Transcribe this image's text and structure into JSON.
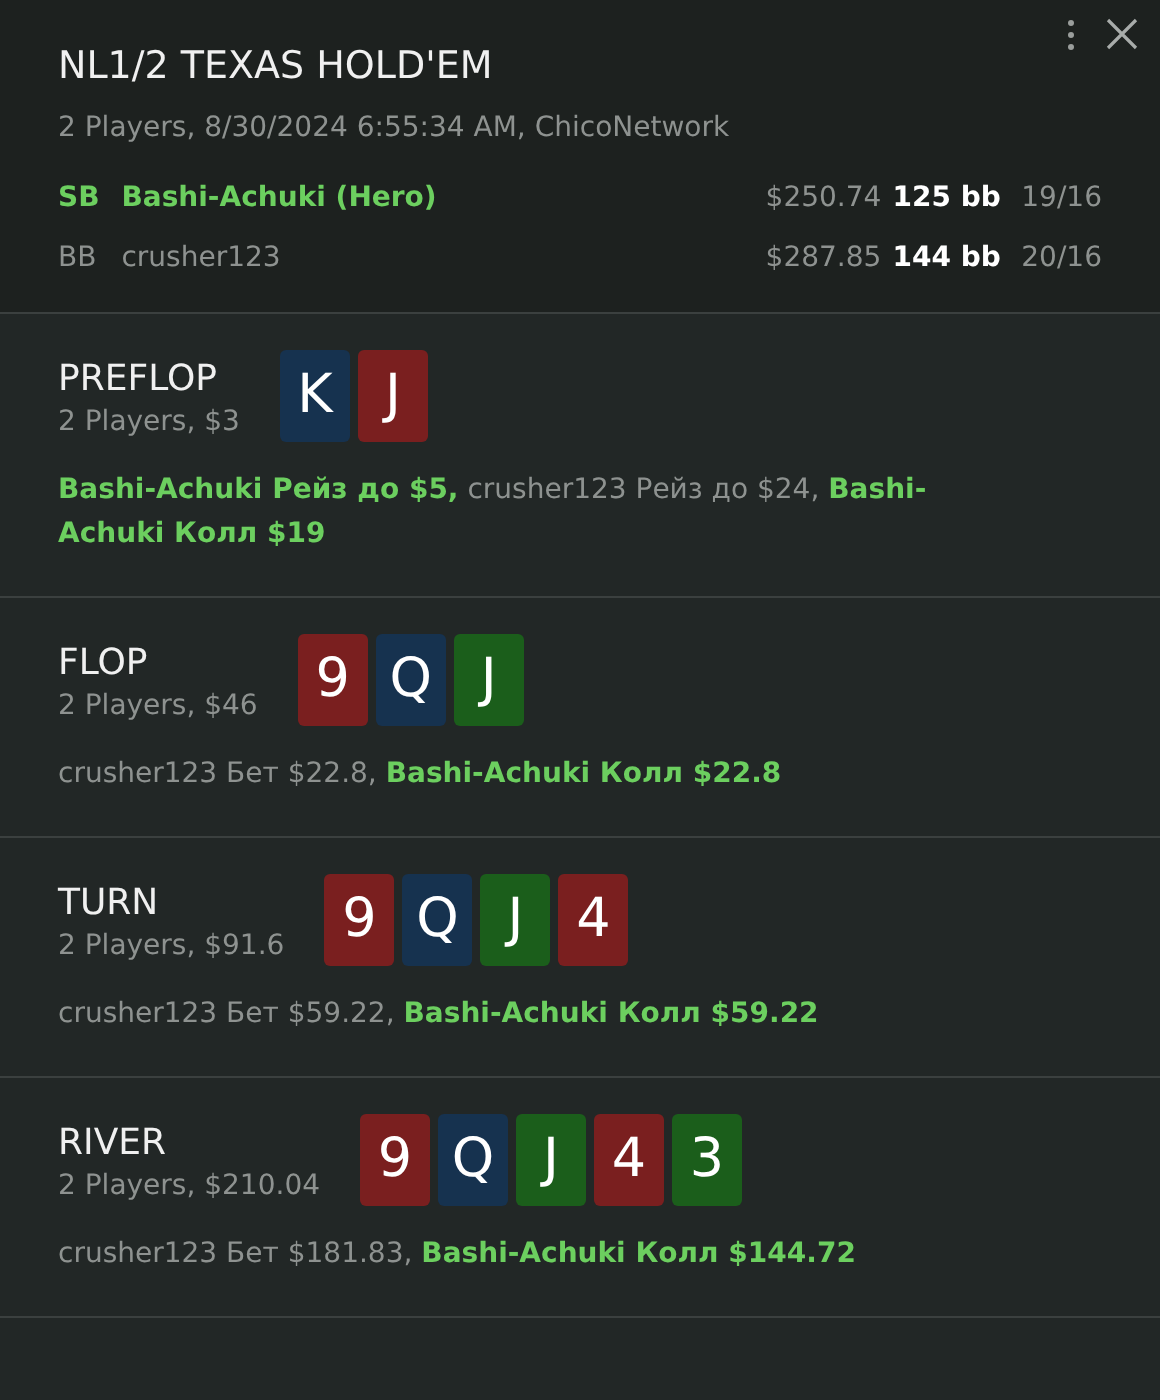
{
  "header": {
    "title": "NL1/2 TEXAS HOLD'EM",
    "subtitle": "2 Players, 8/30/2024 6:55:34 AM, ChicoNetwork",
    "players": [
      {
        "position": "SB",
        "name": "Bashi-Achuki (Hero)",
        "hero": true,
        "stack": "$250.74",
        "bb": "125 bb",
        "stat": "19/16"
      },
      {
        "position": "BB",
        "name": "crusher123",
        "hero": false,
        "stack": "$287.85",
        "bb": "144 bb",
        "stat": "20/16"
      }
    ]
  },
  "streets": [
    {
      "name": "PREFLOP",
      "info": "2 Players, $3",
      "cards": [
        {
          "rank": "K",
          "color": "#16324f"
        },
        {
          "rank": "J",
          "color": "#7a1f1f"
        }
      ],
      "actions": [
        {
          "text": "Bashi-Achuki Рейз до $5,",
          "hero": true
        },
        {
          "text": "crusher123 Рейз до $24,",
          "hero": false
        },
        {
          "text": "Bashi-Achuki Колл $19",
          "hero": true
        }
      ]
    },
    {
      "name": "FLOP",
      "info": "2 Players, $46",
      "cards": [
        {
          "rank": "9",
          "color": "#7a1f1f"
        },
        {
          "rank": "Q",
          "color": "#16324f"
        },
        {
          "rank": "J",
          "color": "#1b5e1b"
        }
      ],
      "actions": [
        {
          "text": "crusher123 Бет $22.8,",
          "hero": false
        },
        {
          "text": "Bashi-Achuki Колл $22.8",
          "hero": true
        }
      ]
    },
    {
      "name": "TURN",
      "info": "2 Players, $91.6",
      "cards": [
        {
          "rank": "9",
          "color": "#7a1f1f"
        },
        {
          "rank": "Q",
          "color": "#16324f"
        },
        {
          "rank": "J",
          "color": "#1b5e1b"
        },
        {
          "rank": "4",
          "color": "#7a1f1f"
        }
      ],
      "actions": [
        {
          "text": "crusher123 Бет $59.22,",
          "hero": false
        },
        {
          "text": "Bashi-Achuki Колл $59.22",
          "hero": true
        }
      ]
    },
    {
      "name": "RIVER",
      "info": "2 Players, $210.04",
      "cards": [
        {
          "rank": "9",
          "color": "#7a1f1f"
        },
        {
          "rank": "Q",
          "color": "#16324f"
        },
        {
          "rank": "J",
          "color": "#1b5e1b"
        },
        {
          "rank": "4",
          "color": "#7a1f1f"
        },
        {
          "rank": "3",
          "color": "#1b5e1b"
        }
      ],
      "actions": [
        {
          "text": "crusher123 Бет $181.83,",
          "hero": false
        },
        {
          "text": "Bashi-Achuki Колл $144.72",
          "hero": true
        }
      ]
    }
  ]
}
